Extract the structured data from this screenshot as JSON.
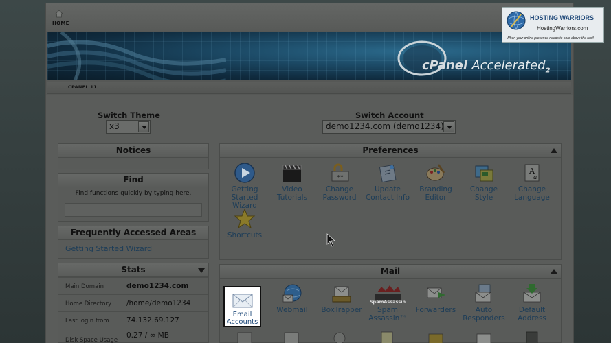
{
  "topbar": {
    "home_label": "HOME"
  },
  "banner": {
    "logo_text": "cPanel",
    "logo_suffix": "Accelerated",
    "logo_version": "2"
  },
  "breadcrumb": {
    "label": "CPANEL 11"
  },
  "switch_theme": {
    "title": "Switch Theme",
    "value": "x3"
  },
  "switch_account": {
    "title": "Switch Account",
    "value": "demo1234.com (demo1234)"
  },
  "notices": {
    "title": "Notices"
  },
  "find": {
    "title": "Find",
    "description": "Find functions quickly by typing here.",
    "value": ""
  },
  "frequent": {
    "title": "Frequently Accessed Areas",
    "items": [
      "Getting Started Wizard"
    ]
  },
  "stats": {
    "title": "Stats",
    "rows": [
      {
        "label": "Main Domain",
        "value": "demo1234.com"
      },
      {
        "label": "Home Directory",
        "value": "/home/demo1234"
      },
      {
        "label": "Last login from",
        "value": "74.132.69.127"
      },
      {
        "label": "Disk Space Usage",
        "value": "0.27 / ∞ MB"
      }
    ]
  },
  "preferences": {
    "title": "Preferences",
    "items": [
      {
        "label": "Getting Started Wizard",
        "icon": "play-icon"
      },
      {
        "label": "Video Tutorials",
        "icon": "clapperboard-icon"
      },
      {
        "label": "Change Password",
        "icon": "password-icon"
      },
      {
        "label": "Update Contact Info",
        "icon": "contact-icon"
      },
      {
        "label": "Branding Editor",
        "icon": "palette-icon"
      },
      {
        "label": "Change Style",
        "icon": "style-icon"
      },
      {
        "label": "Change Language",
        "icon": "language-icon"
      },
      {
        "label": "Shortcuts",
        "icon": "star-icon"
      }
    ]
  },
  "mail": {
    "title": "Mail",
    "items": [
      {
        "label": "Email Accounts",
        "icon": "envelope-icon"
      },
      {
        "label": "Webmail",
        "icon": "webmail-icon"
      },
      {
        "label": "BoxTrapper",
        "icon": "boxtrapper-icon"
      },
      {
        "label": "Spam Assassin™",
        "icon": "spamassassin-icon",
        "badge": "SpamAssassin"
      },
      {
        "label": "Forwarders",
        "icon": "forwarders-icon"
      },
      {
        "label": "Auto Responders",
        "icon": "autoresponder-icon"
      },
      {
        "label": "Default Address",
        "icon": "default-address-icon"
      }
    ]
  },
  "watermark": {
    "title": "HOSTING WARRIORS",
    "url": "HostingWarriors.com",
    "tagline": "When your online presence needs to soar above the rest!"
  }
}
